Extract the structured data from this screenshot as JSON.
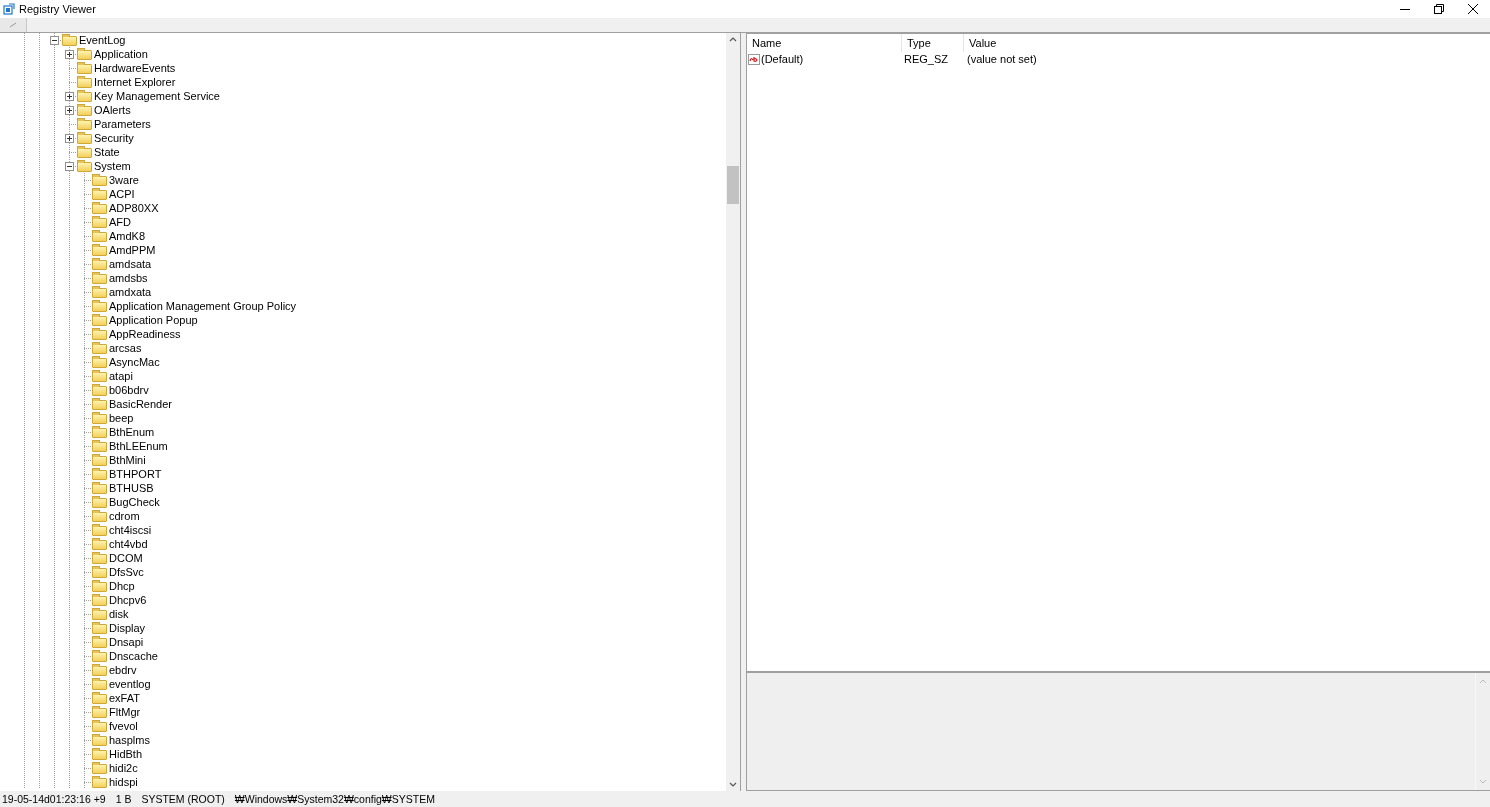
{
  "window": {
    "title": "Registry Viewer"
  },
  "tree": [
    {
      "label": "EventLog",
      "expandable": true,
      "expanded": true,
      "children": [
        {
          "label": "Application",
          "expandable": true,
          "expanded": false
        },
        {
          "label": "HardwareEvents",
          "expandable": false
        },
        {
          "label": "Internet Explorer",
          "expandable": false
        },
        {
          "label": "Key Management Service",
          "expandable": true,
          "expanded": false
        },
        {
          "label": "OAlerts",
          "expandable": true,
          "expanded": false
        },
        {
          "label": "Parameters",
          "expandable": false
        },
        {
          "label": "Security",
          "expandable": true,
          "expanded": false
        },
        {
          "label": "State",
          "expandable": false
        },
        {
          "label": "System",
          "expandable": true,
          "expanded": true,
          "children": [
            {
              "label": "3ware",
              "expandable": false
            },
            {
              "label": "ACPI",
              "expandable": false
            },
            {
              "label": "ADP80XX",
              "expandable": false
            },
            {
              "label": "AFD",
              "expandable": false
            },
            {
              "label": "AmdK8",
              "expandable": false
            },
            {
              "label": "AmdPPM",
              "expandable": false
            },
            {
              "label": "amdsata",
              "expandable": false
            },
            {
              "label": "amdsbs",
              "expandable": false
            },
            {
              "label": "amdxata",
              "expandable": false
            },
            {
              "label": "Application Management Group Policy",
              "expandable": false
            },
            {
              "label": "Application Popup",
              "expandable": false
            },
            {
              "label": "AppReadiness",
              "expandable": false
            },
            {
              "label": "arcsas",
              "expandable": false
            },
            {
              "label": "AsyncMac",
              "expandable": false
            },
            {
              "label": "atapi",
              "expandable": false
            },
            {
              "label": "b06bdrv",
              "expandable": false
            },
            {
              "label": "BasicRender",
              "expandable": false
            },
            {
              "label": "beep",
              "expandable": false
            },
            {
              "label": "BthEnum",
              "expandable": false
            },
            {
              "label": "BthLEEnum",
              "expandable": false
            },
            {
              "label": "BthMini",
              "expandable": false
            },
            {
              "label": "BTHPORT",
              "expandable": false
            },
            {
              "label": "BTHUSB",
              "expandable": false
            },
            {
              "label": "BugCheck",
              "expandable": false
            },
            {
              "label": "cdrom",
              "expandable": false
            },
            {
              "label": "cht4iscsi",
              "expandable": false
            },
            {
              "label": "cht4vbd",
              "expandable": false
            },
            {
              "label": "DCOM",
              "expandable": false
            },
            {
              "label": "DfsSvc",
              "expandable": false
            },
            {
              "label": "Dhcp",
              "expandable": false
            },
            {
              "label": "Dhcpv6",
              "expandable": false
            },
            {
              "label": "disk",
              "expandable": false
            },
            {
              "label": "Display",
              "expandable": false
            },
            {
              "label": "Dnsapi",
              "expandable": false
            },
            {
              "label": "Dnscache",
              "expandable": false
            },
            {
              "label": "ebdrv",
              "expandable": false
            },
            {
              "label": "eventlog",
              "expandable": false
            },
            {
              "label": "exFAT",
              "expandable": false
            },
            {
              "label": "FltMgr",
              "expandable": false
            },
            {
              "label": "fvevol",
              "expandable": false
            },
            {
              "label": "hasplms",
              "expandable": false
            },
            {
              "label": "HidBth",
              "expandable": false
            },
            {
              "label": "hidi2c",
              "expandable": false
            },
            {
              "label": "hidspi",
              "expandable": false
            }
          ]
        }
      ]
    }
  ],
  "values": {
    "columns": [
      "Name",
      "Type",
      "Value"
    ],
    "rows": [
      {
        "name": "(Default)",
        "type": "REG_SZ",
        "value": "(value not set)"
      }
    ]
  },
  "status_bar": [
    "19-05-14d01:23:16 +9",
    "1 B",
    "SYSTEM (ROOT)",
    "₩Windows₩System32₩config₩SYSTEM"
  ]
}
